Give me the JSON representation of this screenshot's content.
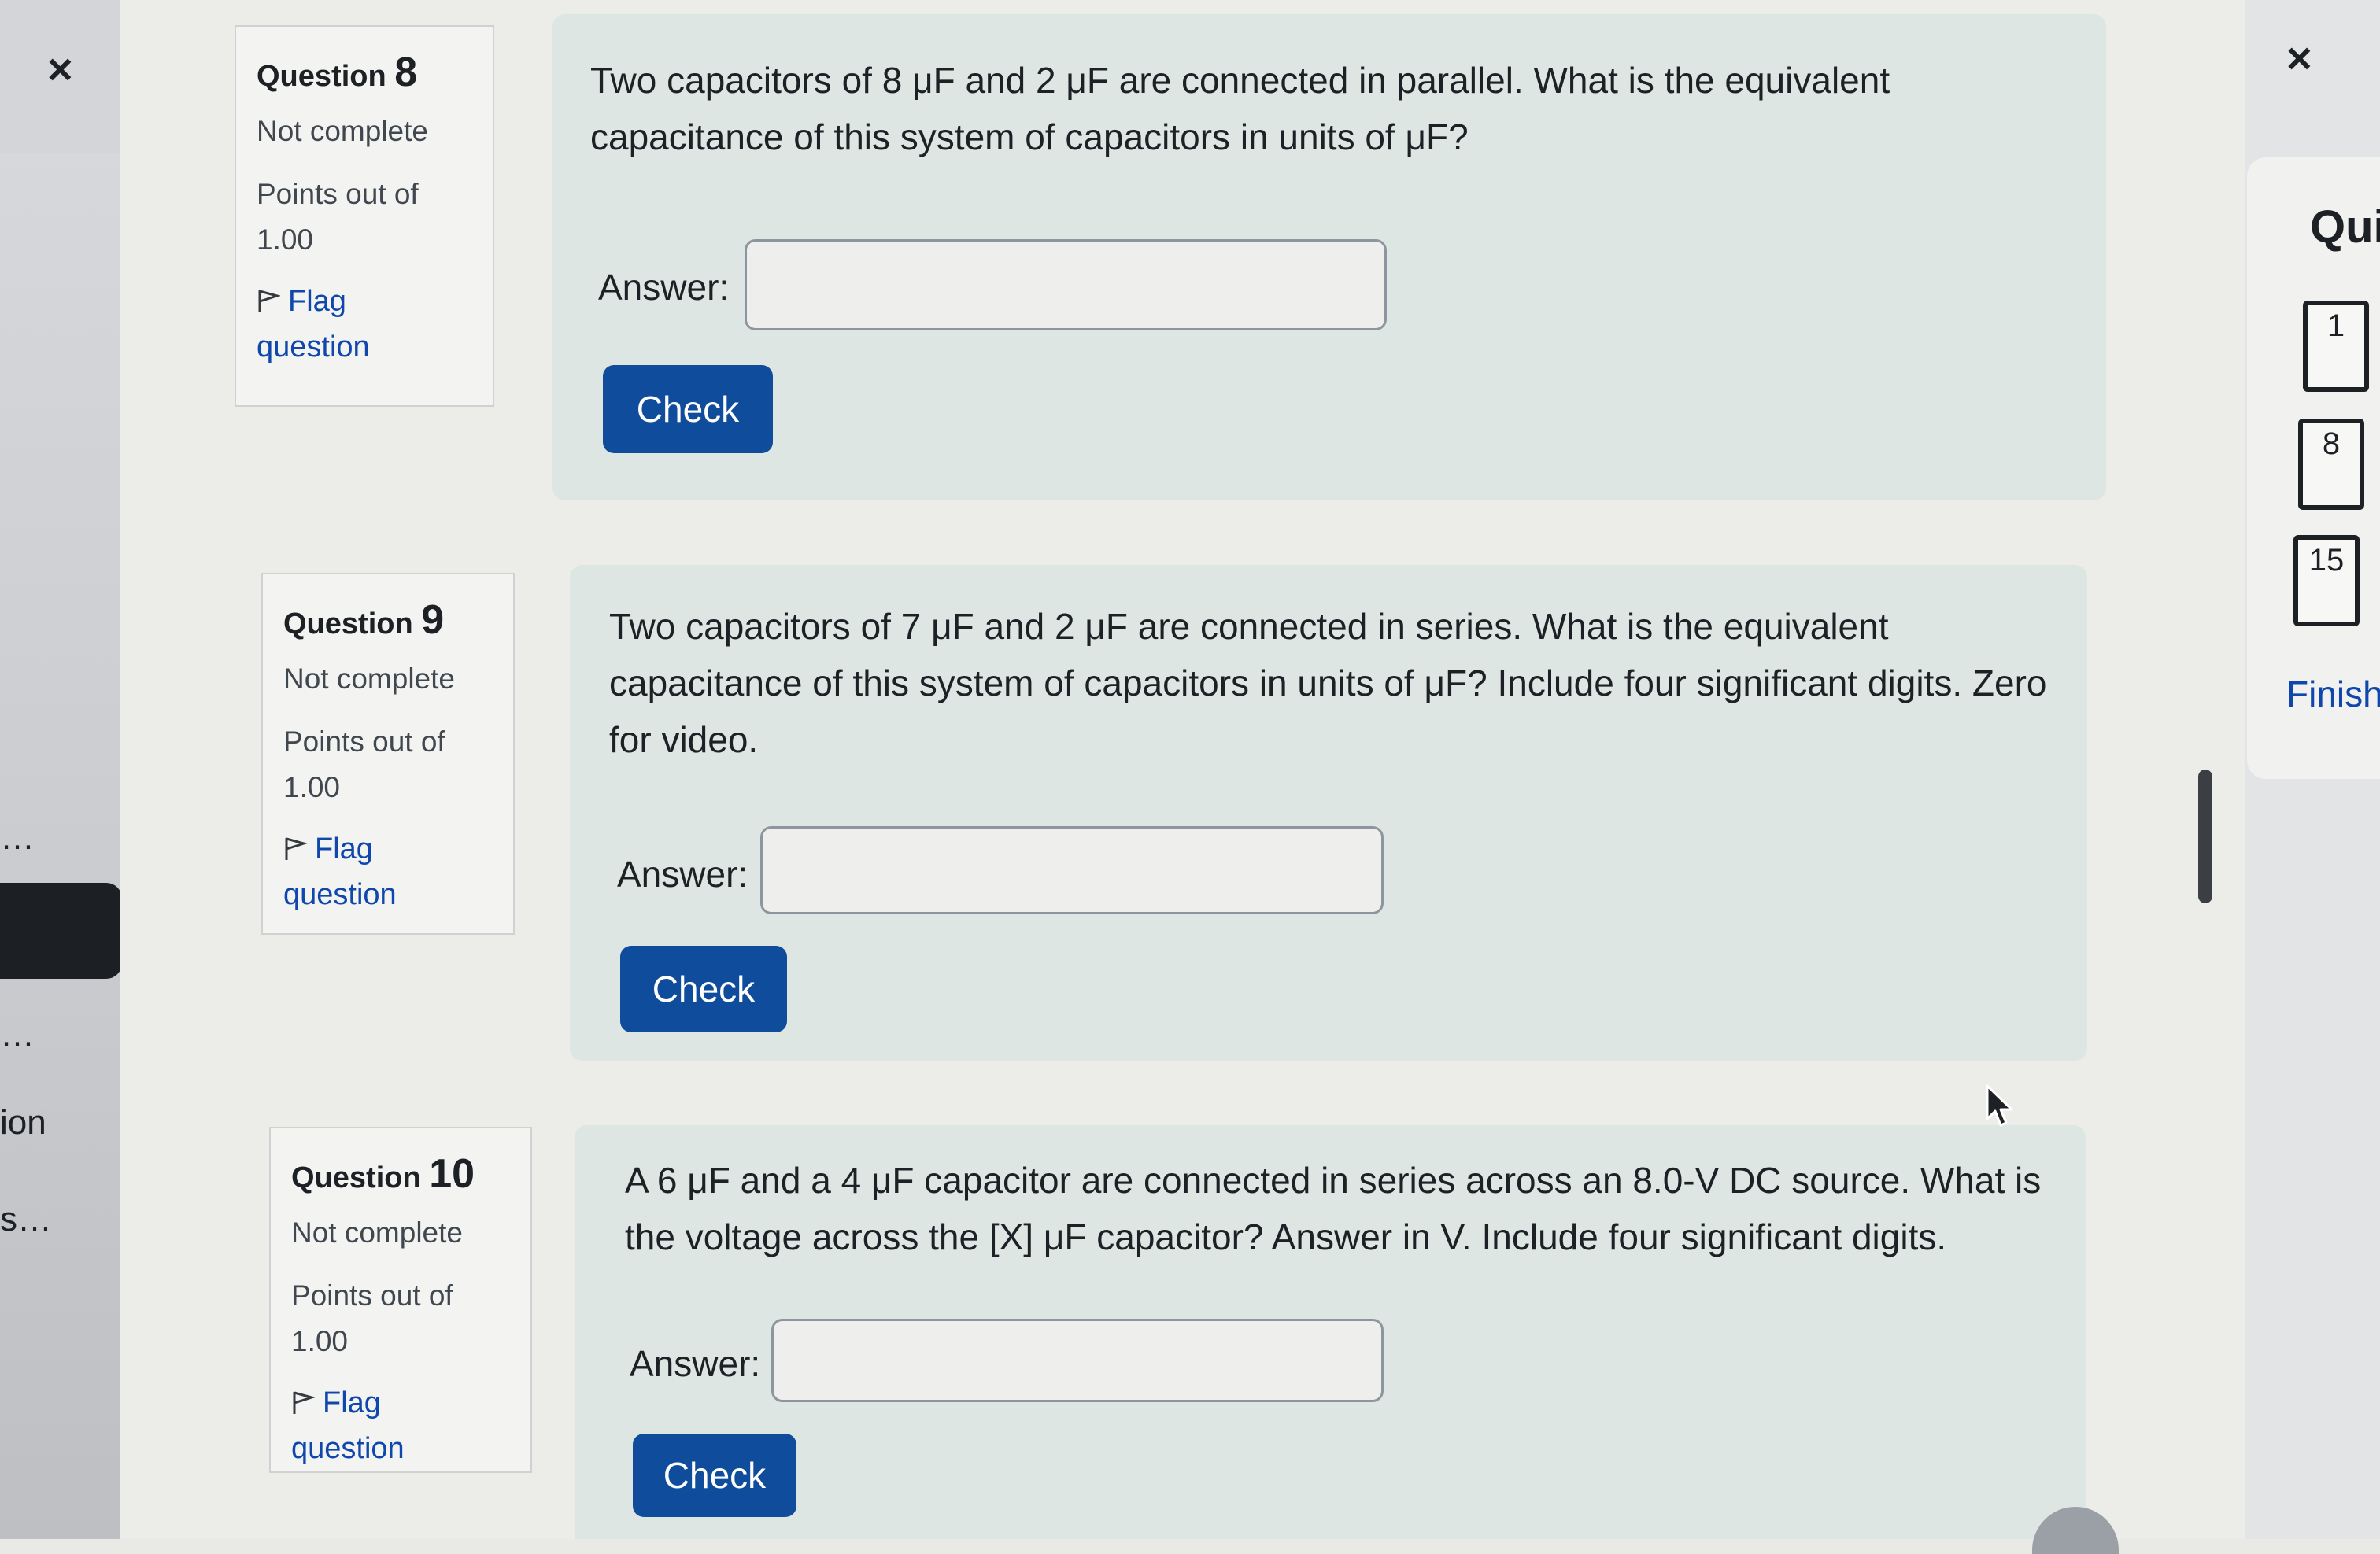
{
  "left_drawer": {
    "close_glyph": "×",
    "item_fragment_1": "…",
    "item_fragment_2": "…",
    "item_fragment_3": "ion",
    "item_fragment_4": "s…"
  },
  "questions": [
    {
      "label": "Question",
      "number": "8",
      "state": "Not complete",
      "points": "Points out of 1.00",
      "flag_label": "Flag question",
      "text": "Two capacitors of 8 μF and 2 μF are connected in parallel. What is the equivalent capacitance of this system of capacitors in units of μF?",
      "answer_label": "Answer:",
      "answer_value": "",
      "check_label": "Check"
    },
    {
      "label": "Question",
      "number": "9",
      "state": "Not complete",
      "points": "Points out of 1.00",
      "flag_label": "Flag question",
      "text": "Two capacitors of 7 μF and 2 μF are connected in series. What is the equivalent capacitance of this system of capacitors in units of μF?  Include four significant digits.  Zero for video.",
      "answer_label": "Answer:",
      "answer_value": "",
      "check_label": "Check"
    },
    {
      "label": "Question",
      "number": "10",
      "state": "Not complete",
      "points": "Points out of 1.00",
      "flag_label": "Flag question",
      "text": "A 6 μF and a 4 μF capacitor are connected in series across an 8.0-V DC source. What is the voltage across the [X] μF capacitor?  Answer in V.  Include four significant digits.",
      "answer_label": "Answer:",
      "answer_value": "",
      "check_label": "Check"
    }
  ],
  "quiz_nav": {
    "close_glyph": "×",
    "title": "Qui",
    "buttons": [
      "1",
      "8",
      "15"
    ],
    "finish_label": "Finish"
  },
  "colors": {
    "primary_button": "#0f4d9c",
    "link": "#0f47ad",
    "content_bg": "#dde6e3"
  }
}
